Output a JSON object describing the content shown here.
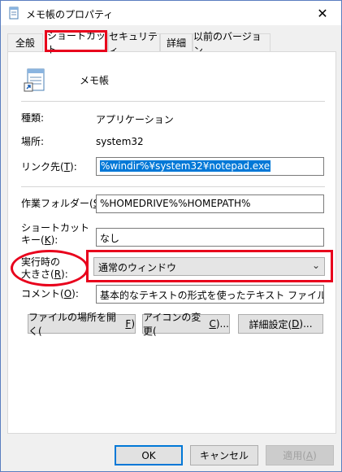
{
  "window": {
    "title": "メモ帳のプロパティ"
  },
  "tabs": [
    {
      "label": "全般"
    },
    {
      "label": "ショートカット"
    },
    {
      "label": "セキュリティ"
    },
    {
      "label": "詳細"
    },
    {
      "label": "以前のバージョン"
    }
  ],
  "header": {
    "name": "メモ帳"
  },
  "info": {
    "type_label": "種類:",
    "type_value": "アプリケーション",
    "location_label": "場所:",
    "location_value": "system32"
  },
  "fields": {
    "target": {
      "label_pre": "リンク先(",
      "key": "T",
      "label_post": "):",
      "value": "%windir%¥system32¥notepad.exe"
    },
    "start_in": {
      "label_pre": "作業フォルダー(",
      "key": "S",
      "label_post": "):",
      "value": "%HOMEDRIVE%%HOMEPATH%"
    },
    "shortcut_key": {
      "label_line1": "ショートカット",
      "label_pre": "キー(",
      "key": "K",
      "label_post": "):",
      "value": "なし"
    },
    "run": {
      "label_line1": "実行時の",
      "label_pre": "大きさ(",
      "key": "R",
      "label_post": "):",
      "value": "通常のウィンドウ"
    },
    "comment": {
      "label_pre": "コメント(",
      "key": "O",
      "label_post": "):",
      "value": "基本的なテキストの形式を使ったテキスト ファイルの表示と編"
    }
  },
  "actions": {
    "open_location": {
      "pre": "ファイルの場所を開く(",
      "key": "F",
      "post": ")"
    },
    "change_icon": {
      "pre": "アイコンの変更(",
      "key": "C",
      "post": ")..."
    },
    "advanced": {
      "pre": "詳細設定(",
      "key": "D",
      "post": ")..."
    }
  },
  "footer": {
    "ok": "OK",
    "cancel": "キャンセル",
    "apply_pre": "適用(",
    "apply_key": "A",
    "apply_post": ")"
  },
  "colors": {
    "highlight": "#e8001c",
    "selection": "#0078d7"
  }
}
